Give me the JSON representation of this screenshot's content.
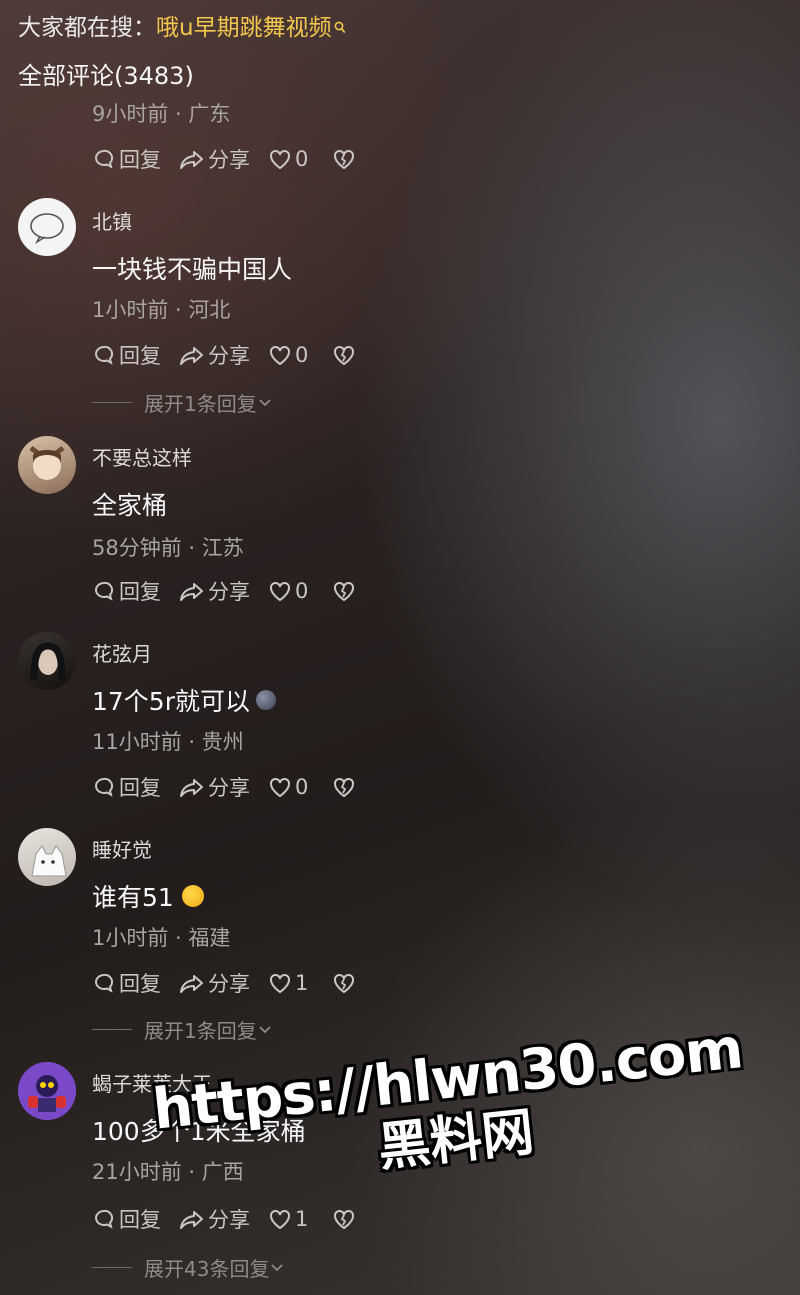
{
  "search": {
    "prefix": "大家都在搜：",
    "term": "哦u早期跳舞视频"
  },
  "comments_header": {
    "title": "全部评论(3483)"
  },
  "actions": {
    "reply": "回复",
    "share": "分享"
  },
  "first_comment_partial": {
    "meta": "9小时前 · 广东",
    "likes": "0"
  },
  "comments": [
    {
      "username": "北镇",
      "text": "一块钱不骗中国人",
      "meta": "1小时前 · 河北",
      "likes": "0",
      "expand": "展开1条回复"
    },
    {
      "username": "不要总这样",
      "text": "全家桶",
      "meta": "58分钟前 · 江苏",
      "likes": "0"
    },
    {
      "username": "花弦月",
      "text": "17个5r就可以",
      "meta": "11小时前 · 贵州",
      "likes": "0"
    },
    {
      "username": "睡好觉",
      "text": "谁有51",
      "meta": "1小时前 · 福建",
      "likes": "1",
      "expand": "展开1条回复"
    },
    {
      "username": "蝎子莱莱大王",
      "text": "100多个1米全家桶",
      "meta": "21小时前 · 广西",
      "likes": "1",
      "expand": "展开43条回复"
    }
  ],
  "watermark": {
    "line1": "https://hlwn30.com",
    "line2": "黑料网"
  },
  "colors": {
    "search_term": "#f3c64d",
    "meta": "#a8a4a2",
    "text": "#f7f7f7"
  }
}
